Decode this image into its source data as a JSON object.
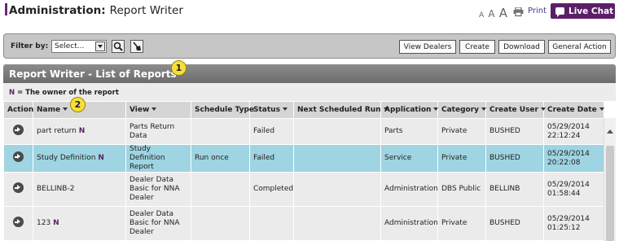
{
  "header": {
    "title_bold": "Administration:",
    "title_rest": "Report Writer"
  },
  "utilities": {
    "font_small": "A",
    "font_medium": "A",
    "font_large": "A",
    "print_label": "Print",
    "chat_label": "Live Chat"
  },
  "toolbar": {
    "filter_label": "Filter by:",
    "filter_value": "Select...",
    "buttons": [
      "View Dealers",
      "Create",
      "Download",
      "General Action"
    ]
  },
  "section": {
    "title": "Report Writer - List of Reports",
    "owner_note": "= The owner of the report",
    "owner_mark": "N"
  },
  "callouts": [
    "1",
    "2"
  ],
  "table": {
    "columns": [
      "Action",
      "Name",
      "View",
      "Schedule Type",
      "Status",
      "Next Scheduled Run",
      "Application",
      "Category",
      "Create User",
      "Create Date"
    ],
    "rows": [
      {
        "name": "part return",
        "owner": "N",
        "view": "Parts Return Data",
        "schedule": "",
        "status": "Failed",
        "next_run": "",
        "application": "Parts",
        "category": "Private",
        "user": "BUSHED",
        "date": "05/29/2014 22:12:24"
      },
      {
        "name": "Study Definition",
        "owner": "N",
        "view": "Study Definition Report",
        "schedule": "Run once",
        "status": "Failed",
        "next_run": "",
        "application": "Service",
        "category": "Private",
        "user": "BUSHED",
        "date": "05/29/2014 20:22:08"
      },
      {
        "name": "BELLINB-2",
        "owner": "",
        "view": "Dealer Data Basic for NNA Dealer",
        "schedule": "",
        "status": "Completed",
        "next_run": "",
        "application": "Administration",
        "category": "DBS Public",
        "user": "BELLINB",
        "date": "05/29/2014 01:58:44"
      },
      {
        "name": "123",
        "owner": "N",
        "view": "Dealer Data Basic for NNA Dealer",
        "schedule": "",
        "status": "",
        "next_run": "",
        "application": "Administration",
        "category": "Private",
        "user": "BUSHED",
        "date": "05/29/2014 01:25:12"
      }
    ]
  }
}
